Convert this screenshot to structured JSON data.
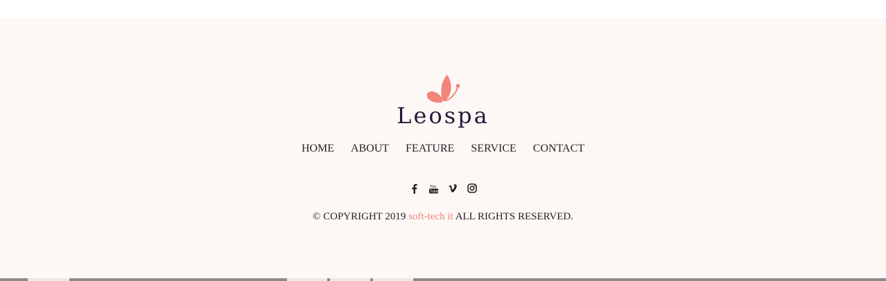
{
  "brand": {
    "name": "Leospa",
    "logo_icon": "butterfly-icon",
    "accent_color": "#f2847a",
    "text_color": "#1f1a3a"
  },
  "nav": {
    "items": [
      {
        "label": "HOME"
      },
      {
        "label": "ABOUT"
      },
      {
        "label": "FEATURE"
      },
      {
        "label": "SERVICE"
      },
      {
        "label": "CONTACT"
      }
    ]
  },
  "social": {
    "icons": [
      "facebook-icon",
      "youtube-icon",
      "vimeo-icon",
      "instagram-icon"
    ]
  },
  "copyright": {
    "prefix": "© COPYRIGHT 2019 ",
    "company": "soft-tech it",
    "suffix": " ALL RIGHTS RESERVED."
  },
  "colors": {
    "footer_bg": "#fdf8f6"
  }
}
